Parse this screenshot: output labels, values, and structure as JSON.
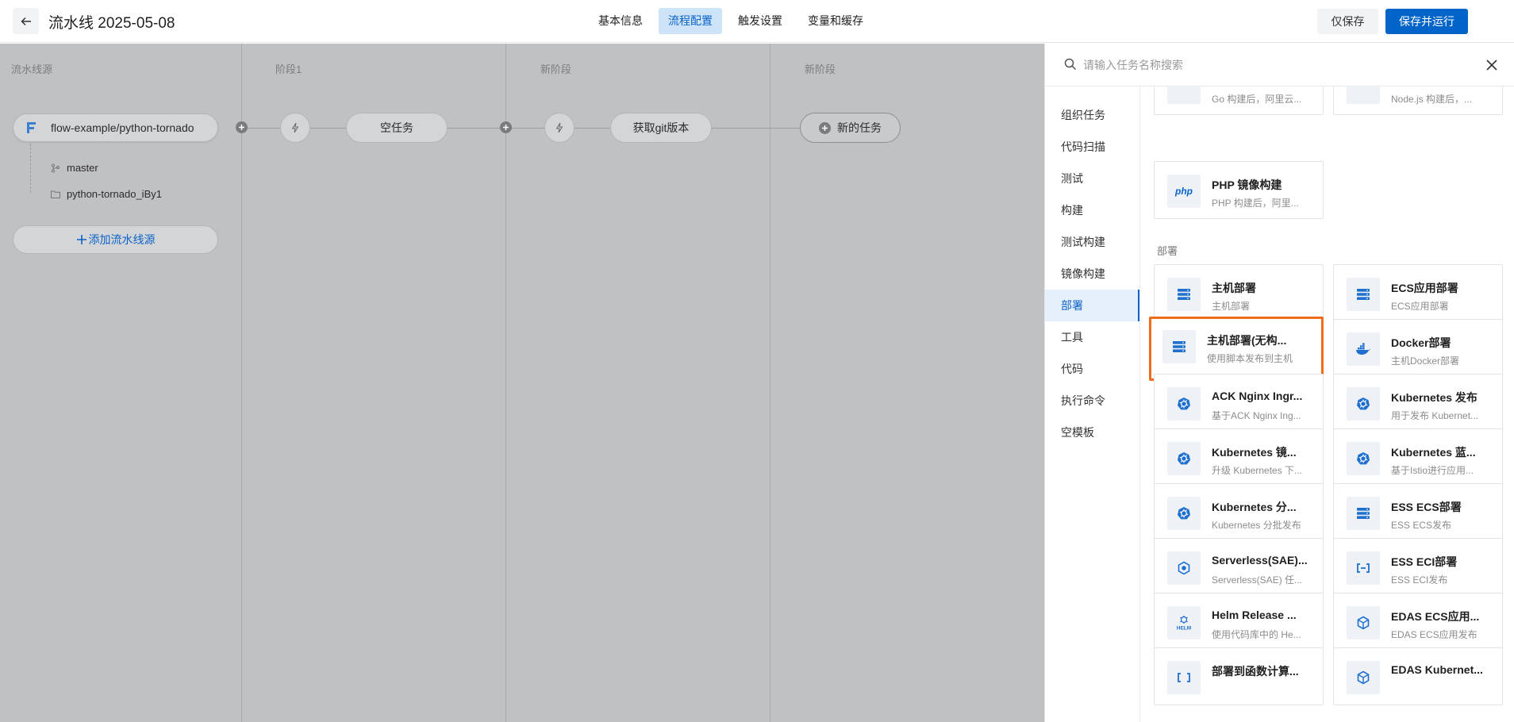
{
  "header": {
    "title": "流水线 2025-05-08",
    "tabs": [
      {
        "label": "基本信息"
      },
      {
        "label": "流程配置"
      },
      {
        "label": "触发设置"
      },
      {
        "label": "变量和缓存"
      }
    ],
    "active_tab": "流程配置",
    "save_label": "仅保存",
    "save_run_label": "保存并运行"
  },
  "canvas": {
    "stages": [
      {
        "title": "流水线源"
      },
      {
        "title": "阶段1"
      },
      {
        "title": "新阶段"
      },
      {
        "title": "新阶段"
      }
    ],
    "source": {
      "repo": "flow-example/python-tornado",
      "branch": "master",
      "alias": "python-tornado_iBy1",
      "add_label": "添加流水线源"
    },
    "tasks": [
      {
        "label": "空任务"
      },
      {
        "label": "获取git版本"
      }
    ],
    "new_task_label": "新的任务"
  },
  "drawer": {
    "search_placeholder": "请输入任务名称搜索",
    "categories": [
      {
        "label": "组织任务"
      },
      {
        "label": "代码扫描"
      },
      {
        "label": "测试"
      },
      {
        "label": "构建"
      },
      {
        "label": "测试构建"
      },
      {
        "label": "镜像构建"
      },
      {
        "label": "部署"
      },
      {
        "label": "工具"
      },
      {
        "label": "代码"
      },
      {
        "label": "执行命令"
      },
      {
        "label": "空模板"
      }
    ],
    "active_category": "部署",
    "partial_cards": [
      {
        "desc": "Go 构建后，阿里云...",
        "icon": "go-icon"
      },
      {
        "desc": "Node.js 构建后，...",
        "icon": "nodejs-icon"
      }
    ],
    "php_card": {
      "title": "PHP 镜像构建",
      "desc": "PHP 构建后，阿里...",
      "icon": "php-icon",
      "icon_text": "php"
    },
    "section_deploy": "部署",
    "deploy_cards": [
      {
        "title": "主机部署",
        "desc": "主机部署",
        "icon": "server-icon"
      },
      {
        "title": "ECS应用部署",
        "desc": "ECS应用部署",
        "icon": "server-icon"
      },
      {
        "title": "主机部署(无构...",
        "desc": "使用脚本发布到主机",
        "icon": "server-icon",
        "highlighted": true
      },
      {
        "title": "Docker部署",
        "desc": "主机Docker部署",
        "icon": "docker-icon"
      },
      {
        "title": "ACK Nginx Ingr...",
        "desc": "基于ACK Nginx Ing...",
        "icon": "kubernetes-icon"
      },
      {
        "title": "Kubernetes 发布",
        "desc": "用于发布 Kubernet...",
        "icon": "kubernetes-icon"
      },
      {
        "title": "Kubernetes 镜...",
        "desc": "升级 Kubernetes 下...",
        "icon": "kubernetes-icon"
      },
      {
        "title": "Kubernetes 蓝...",
        "desc": "基于Istio进行应用...",
        "icon": "kubernetes-icon"
      },
      {
        "title": "Kubernetes 分...",
        "desc": "Kubernetes 分批发布",
        "icon": "kubernetes-icon"
      },
      {
        "title": "ESS ECS部署",
        "desc": "ESS ECS发布",
        "icon": "server-icon"
      },
      {
        "title": "Serverless(SAE)...",
        "desc": "Serverless(SAE) 任...",
        "icon": "sae-icon"
      },
      {
        "title": "ESS ECI部署",
        "desc": "ESS ECI发布",
        "icon": "eci-icon"
      },
      {
        "title": "Helm Release ...",
        "desc": "使用代码库中的 He...",
        "icon": "helm-icon",
        "icon_text": "HELM"
      },
      {
        "title": "EDAS ECS应用...",
        "desc": "EDAS ECS应用发布",
        "icon": "edas-icon"
      },
      {
        "title": "部署到函数计算...",
        "desc": "",
        "icon": "function-compute-icon"
      },
      {
        "title": "EDAS Kubernet...",
        "desc": "",
        "icon": "edas-icon"
      }
    ]
  },
  "colors": {
    "primary": "#0064c8",
    "highlight": "#ef6c1a",
    "overlay": "#c0c1c3"
  }
}
